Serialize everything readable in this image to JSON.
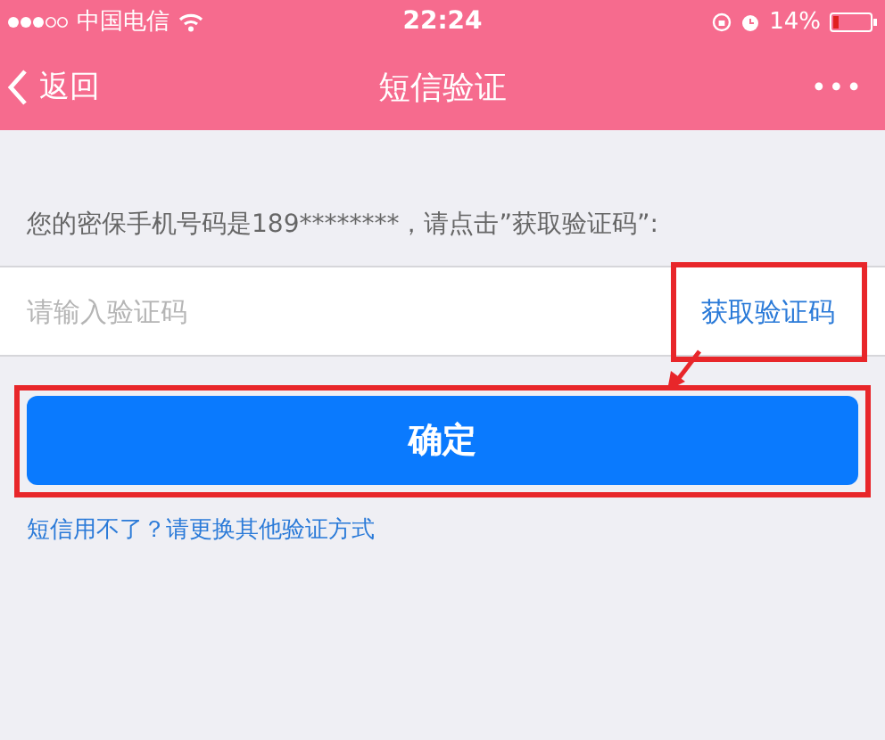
{
  "status_bar": {
    "carrier": "中国电信",
    "time": "22:24",
    "battery": "14%"
  },
  "nav_bar": {
    "back": "返回",
    "title": "短信验证",
    "more": "•••"
  },
  "instruction": "您的密保手机号码是189********，请点击”获取验证码”:",
  "code_field": {
    "placeholder": "请输入验证码",
    "get_code": "获取验证码"
  },
  "confirm_button": "确定",
  "alt_link": "短信用不了？请更换其他验证方式"
}
